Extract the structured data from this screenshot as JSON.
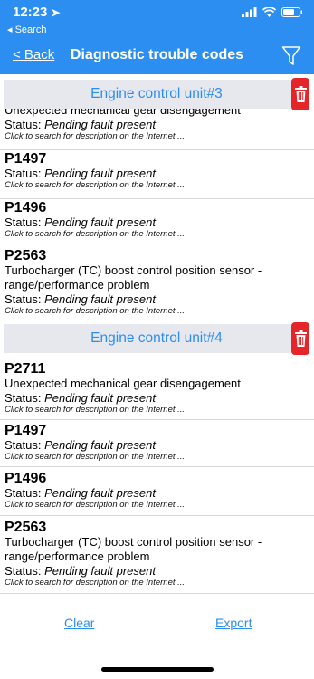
{
  "status_bar": {
    "time": "12:23",
    "back_app": "◂ Search"
  },
  "nav": {
    "back": "< Back",
    "title": "Diagnostic trouble codes"
  },
  "units": [
    {
      "title": "Engine control unit#3",
      "faults": [
        {
          "code": "",
          "desc": "Unexpected mechanical gear disengagement",
          "status_label": "Status:",
          "status": "Pending fault present",
          "hint": "Click to search for description on the Internet ..."
        },
        {
          "code": "P1497",
          "desc": "",
          "status_label": "Status:",
          "status": "Pending fault present",
          "hint": "Click to search for description on the Internet ..."
        },
        {
          "code": "P1496",
          "desc": "",
          "status_label": "Status:",
          "status": "Pending fault present",
          "hint": "Click to search for description on the Internet ..."
        },
        {
          "code": "P2563",
          "desc": "Turbocharger (TC) boost control position sensor - range/performance problem",
          "status_label": "Status:",
          "status": "Pending fault present",
          "hint": "Click to search for description on the Internet ..."
        }
      ]
    },
    {
      "title": "Engine control unit#4",
      "faults": [
        {
          "code": "P2711",
          "desc": "Unexpected mechanical gear disengagement",
          "status_label": "Status:",
          "status": "Pending fault present",
          "hint": "Click to search for description on the Internet ..."
        },
        {
          "code": "P1497",
          "desc": "",
          "status_label": "Status:",
          "status": "Pending fault present",
          "hint": "Click to search for description on the Internet ..."
        },
        {
          "code": "P1496",
          "desc": "",
          "status_label": "Status:",
          "status": "Pending fault present",
          "hint": "Click to search for description on the Internet ..."
        },
        {
          "code": "P2563",
          "desc": "Turbocharger (TC) boost control position sensor - range/performance problem",
          "status_label": "Status:",
          "status": "Pending fault present",
          "hint": "Click to search for description on the Internet ..."
        }
      ]
    }
  ],
  "actions": {
    "clear": "Clear",
    "export": "Export"
  },
  "colors": {
    "accent": "#2b8ef0",
    "trash": "#e6252b",
    "section_bg": "#e7e8ee"
  },
  "icons": [
    "location-arrow-icon",
    "signal-icon",
    "wifi-icon",
    "battery-icon",
    "filter-icon",
    "trash-icon"
  ]
}
